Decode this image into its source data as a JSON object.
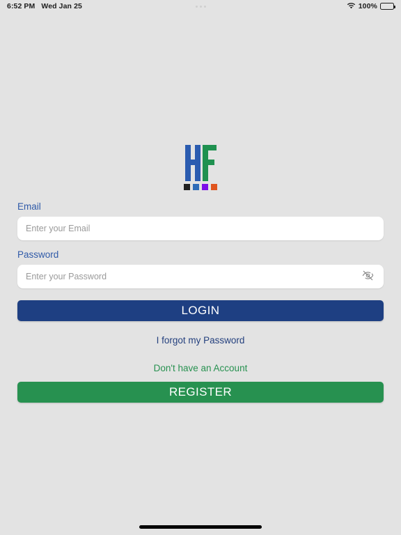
{
  "status_bar": {
    "time": "6:52 PM",
    "date": "Wed Jan 25",
    "wifi_icon": "wifi-icon",
    "battery_percent": "100%",
    "battery_icon": "battery-icon",
    "multitask_dots": "multitasking-dots"
  },
  "logo": {
    "letter_h": "H",
    "letter_f": "F",
    "h_color": "#2b5cb0",
    "f_color": "#1f9150",
    "squares": [
      {
        "name": "square-black",
        "color": "#212121"
      },
      {
        "name": "square-blue",
        "color": "#2f6cb8"
      },
      {
        "name": "square-purple",
        "color": "#7b0fe8"
      },
      {
        "name": "square-orange",
        "color": "#e0551f"
      }
    ]
  },
  "form": {
    "email": {
      "label": "Email",
      "placeholder": "Enter your Email",
      "value": ""
    },
    "password": {
      "label": "Password",
      "placeholder": "Enter your Password",
      "value": "",
      "toggle_icon": "eye-off-icon"
    }
  },
  "actions": {
    "login_label": "LOGIN",
    "forgot_password_label": "I forgot my Password",
    "no_account_label": "Don't have an Account",
    "register_label": "REGISTER"
  },
  "colors": {
    "background": "#e3e3e3",
    "primary_blue": "#1e3f82",
    "label_blue": "#2f5aa8",
    "link_blue": "#24407e",
    "primary_green": "#279150"
  }
}
